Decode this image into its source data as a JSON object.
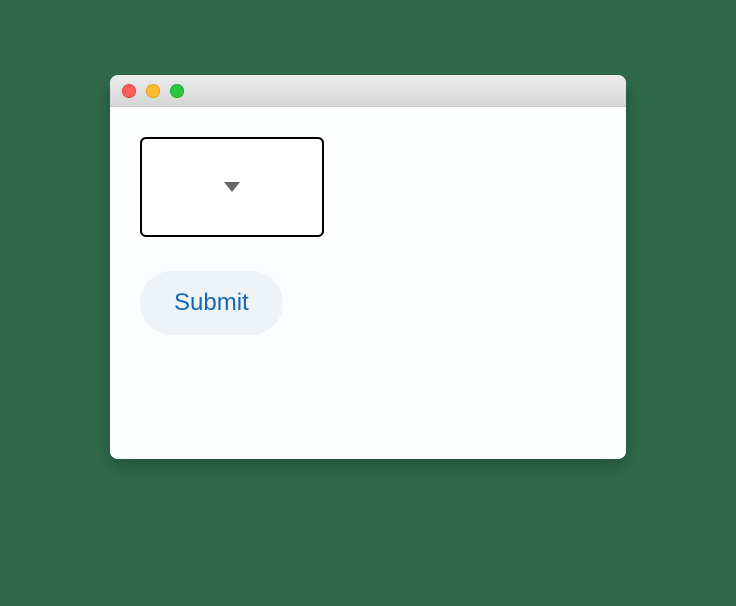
{
  "window": {
    "title": ""
  },
  "form": {
    "dropdown": {
      "selected": ""
    },
    "submit_label": "Submit"
  }
}
